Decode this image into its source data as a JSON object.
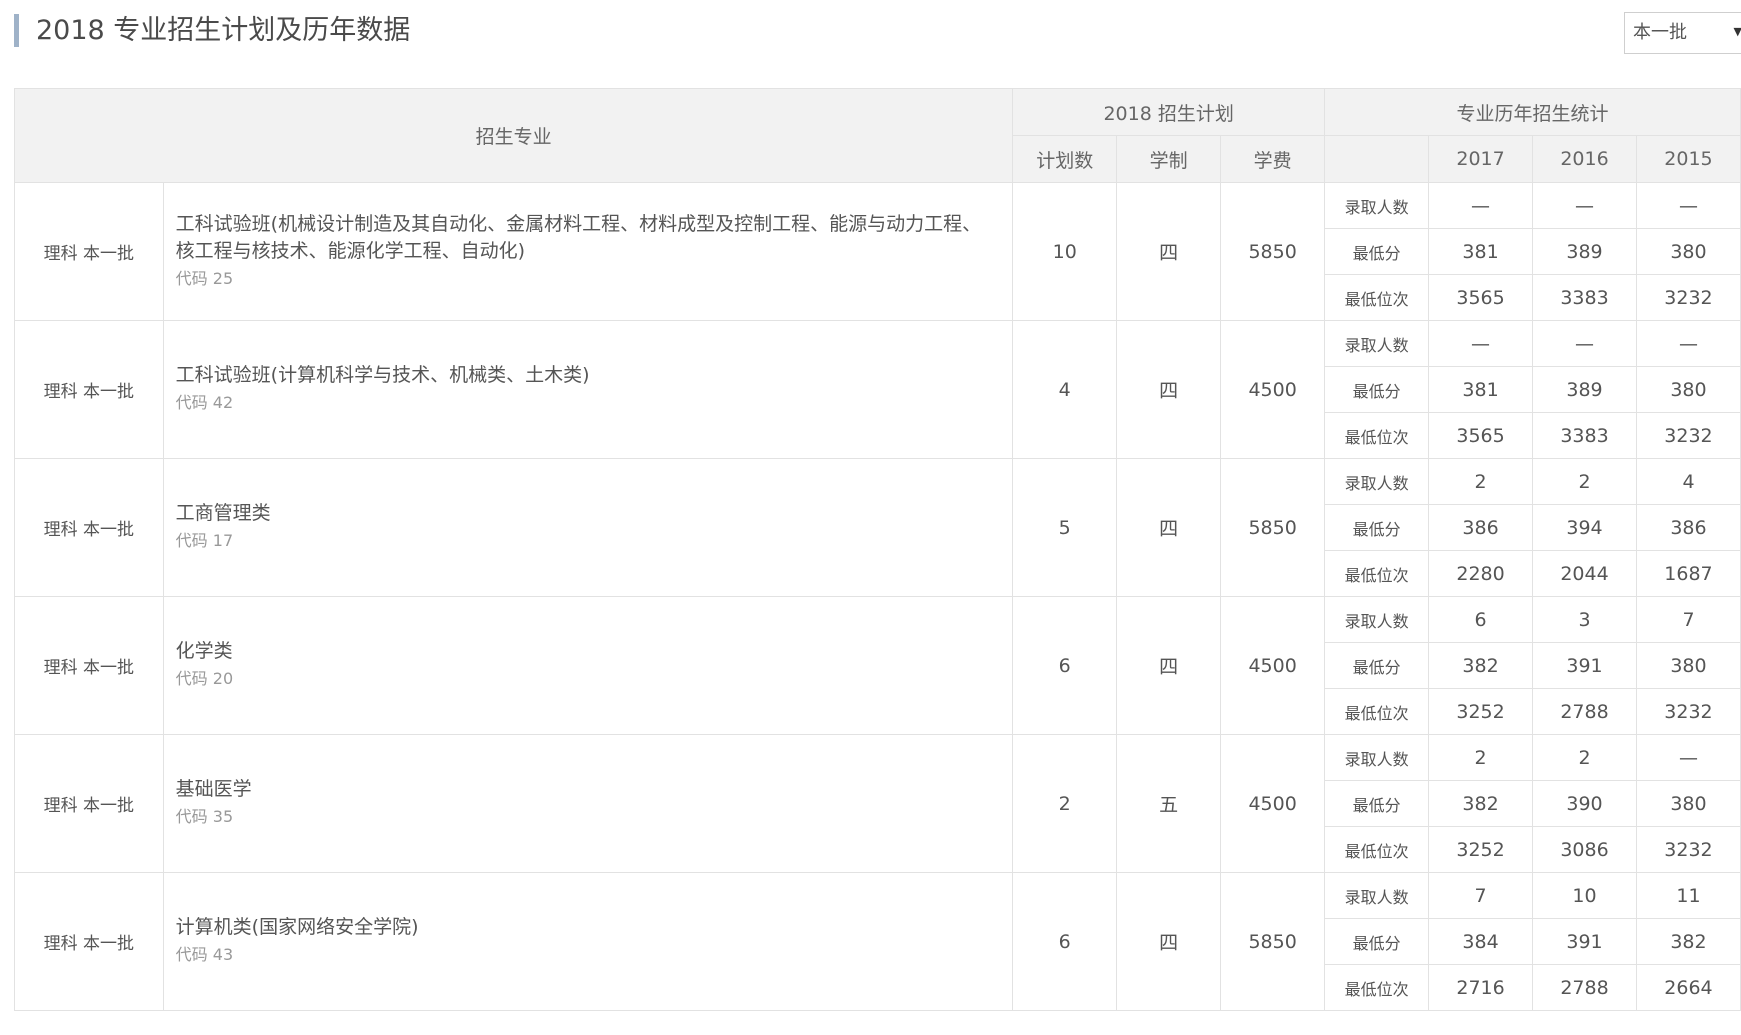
{
  "header": {
    "title": "2018 专业招生计划及历年数据",
    "batch_select": {
      "value": "本一批",
      "arrow": "▼"
    }
  },
  "table": {
    "columns": {
      "major": "招生专业",
      "plan_group": "2018 招生计划",
      "plan_count": "计划数",
      "duration": "学制",
      "tuition": "学费",
      "history_group": "专业历年招生统计",
      "years": [
        "2017",
        "2016",
        "2015"
      ]
    },
    "metric_labels": [
      "录取人数",
      "最低分",
      "最低位次"
    ],
    "rows": [
      {
        "batch": "理科 本一批",
        "major": "工科试验班(机械设计制造及其自动化、金属材料工程、材料成型及控制工程、能源与动力工程、核工程与核技术、能源化学工程、自动化)",
        "code": "代码 25",
        "plan": "10",
        "duration": "四",
        "tuition": "5850",
        "stats": [
          [
            "—",
            "—",
            "—"
          ],
          [
            "381",
            "389",
            "380"
          ],
          [
            "3565",
            "3383",
            "3232"
          ]
        ]
      },
      {
        "batch": "理科 本一批",
        "major": "工科试验班(计算机科学与技术、机械类、土木类)",
        "code": "代码 42",
        "plan": "4",
        "duration": "四",
        "tuition": "4500",
        "stats": [
          [
            "—",
            "—",
            "—"
          ],
          [
            "381",
            "389",
            "380"
          ],
          [
            "3565",
            "3383",
            "3232"
          ]
        ]
      },
      {
        "batch": "理科 本一批",
        "major": "工商管理类",
        "code": "代码 17",
        "plan": "5",
        "duration": "四",
        "tuition": "5850",
        "stats": [
          [
            "2",
            "2",
            "4"
          ],
          [
            "386",
            "394",
            "386"
          ],
          [
            "2280",
            "2044",
            "1687"
          ]
        ]
      },
      {
        "batch": "理科 本一批",
        "major": "化学类",
        "code": "代码 20",
        "plan": "6",
        "duration": "四",
        "tuition": "4500",
        "stats": [
          [
            "6",
            "3",
            "7"
          ],
          [
            "382",
            "391",
            "380"
          ],
          [
            "3252",
            "2788",
            "3232"
          ]
        ]
      },
      {
        "batch": "理科 本一批",
        "major": "基础医学",
        "code": "代码 35",
        "plan": "2",
        "duration": "五",
        "tuition": "4500",
        "stats": [
          [
            "2",
            "2",
            "—"
          ],
          [
            "382",
            "390",
            "380"
          ],
          [
            "3252",
            "3086",
            "3232"
          ]
        ]
      },
      {
        "batch": "理科 本一批",
        "major": "计算机类(国家网络安全学院)",
        "code": "代码 43",
        "plan": "6",
        "duration": "四",
        "tuition": "5850",
        "stats": [
          [
            "7",
            "10",
            "11"
          ],
          [
            "384",
            "391",
            "382"
          ],
          [
            "2716",
            "2788",
            "2664"
          ]
        ]
      }
    ]
  }
}
